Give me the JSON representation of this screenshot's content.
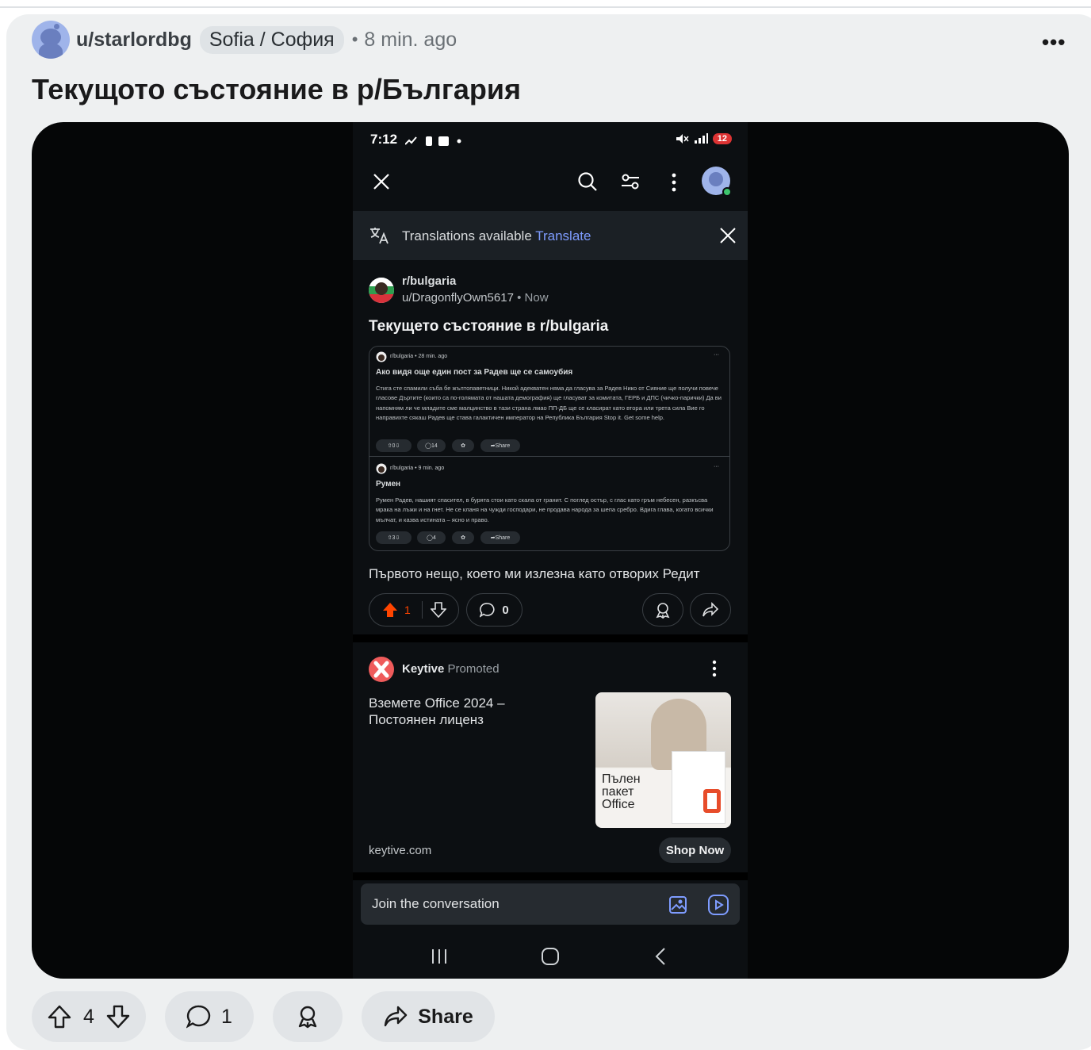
{
  "post": {
    "username": "u/starlordbg",
    "flair": "Sofia / София",
    "separator": "•",
    "time": "8 min. ago",
    "more_label": "•••",
    "title": "Текущото състояние в р/България"
  },
  "phone": {
    "status_time": "7:12",
    "battery": "12",
    "translation": {
      "label": "Translations available",
      "link": "Translate"
    },
    "post": {
      "subreddit": "r/bulgaria",
      "user": "u/DragonflyOwn5617",
      "dot": "•",
      "time": "Now",
      "title": "Текущето състояние в r/bulgaria",
      "embed": {
        "first": {
          "meta": "r/bulgaria • 28 min. ago",
          "more": "···",
          "heading": "Ако видя още един пост за Радев ще се самоубия",
          "body": "Стига сте спамили съба бе жълтопаветници. Никой адекватен няма да гласува за Радев Нико от Сияние ще получи повече гласове Дъртите (които са по-голямата от нашата демография) ще гласуват за комитата, ГЕРБ и ДПС (чичко-парички) Да ви напомням ли че младите сме малцинство в тази страна лмао ПП-ДБ ще се класират като втора или трета сила Вие го направихте сякаш Радев ще става галактичен император на Република България Stop it. Get some help.",
          "votes": "0",
          "comments": "14",
          "share": "Share"
        },
        "second": {
          "meta": "r/bulgaria • 9 min. ago",
          "more": "···",
          "heading": "Румен",
          "body": "Румен Радев, нашият спасител, в бурята стои като скала от гранит. С поглед остър, с глас като гръм небесен, разкъсва мрака на лъжи и на гнет. Не се кланя на чужди господари, не продава народа за шепа сребро. Вдига глава, когато всички мълчат, и казва истината – ясно и право.",
          "votes": "3",
          "comments": "4",
          "share": "Share"
        }
      },
      "caption": "Първото нещо, което ми излезна като отворих Редит",
      "upvotes": "1",
      "comments": "0"
    },
    "ad": {
      "name": "Keytive",
      "promoted": "Promoted",
      "text": "Вземете Office 2024 – Постоянен лиценз",
      "image_text": "Пълен пакет Office",
      "domain": "keytive.com",
      "cta": "Shop Now"
    },
    "join_placeholder": "Join the conversation"
  },
  "actions": {
    "votes": "4",
    "comments": "1",
    "share": "Share"
  },
  "colors": {
    "upvote": "#ff4500",
    "link": "#7e9cff",
    "card_bg": "#eef0f1"
  }
}
